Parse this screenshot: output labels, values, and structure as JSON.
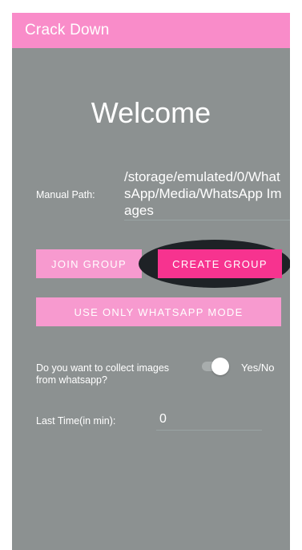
{
  "app": {
    "title": "Crack Down"
  },
  "main": {
    "welcome": "Welcome",
    "manual_path_label": "Manual Path:",
    "manual_path_value": "/storage/emulated/0/WhatsApp/Media/WhatsApp Images",
    "join_group_label": "JOIN GROUP",
    "create_group_label": "CREATE GROUP",
    "whatsapp_mode_label": "USE ONLY WHATSAPP MODE",
    "collect_question": "Do you want to collect images from whatsapp?",
    "switch_label": "Yes/No",
    "switch_state": "off",
    "last_time_label": "Last Time(in min):",
    "last_time_value": "0"
  },
  "colors": {
    "app_bar": "#f98cc9",
    "background": "#8c9191",
    "button_light": "#f79acf",
    "button_accent": "#f7338f"
  }
}
